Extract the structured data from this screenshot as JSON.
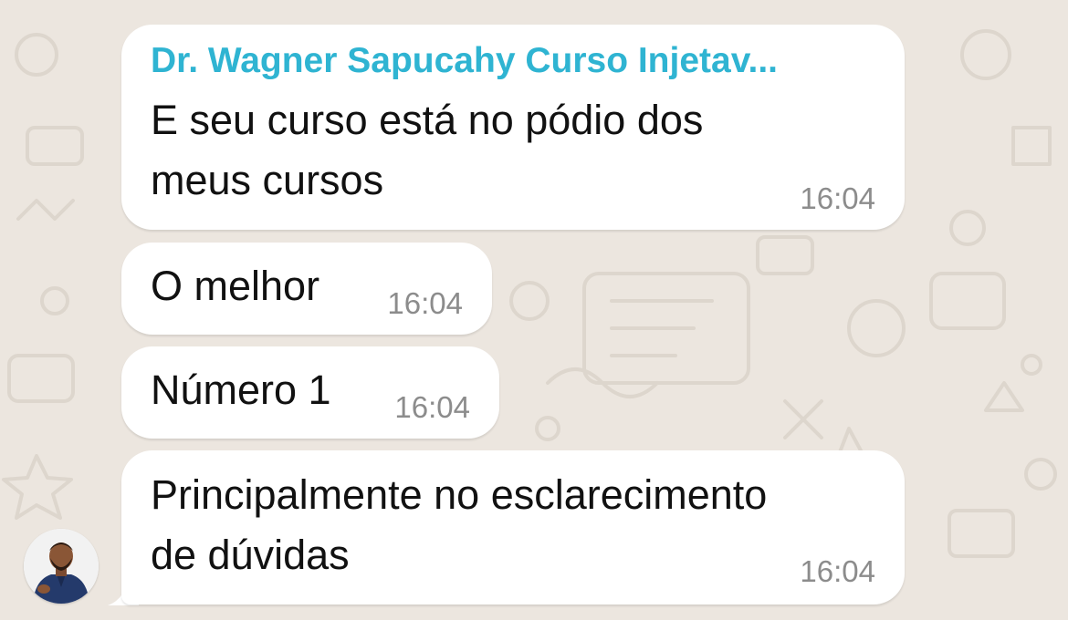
{
  "chat": {
    "sender_name": "Dr. Wagner Sapucahy Curso Injetav...",
    "messages": [
      {
        "lines": [
          "E seu curso está no pódio dos",
          "meus cursos"
        ],
        "time": "16:04"
      },
      {
        "lines": [
          "O melhor"
        ],
        "time": "16:04"
      },
      {
        "lines": [
          "Número 1"
        ],
        "time": "16:04"
      },
      {
        "lines": [
          "Principalmente no esclarecimento",
          "de dúvidas"
        ],
        "time": "16:04"
      }
    ]
  },
  "colors": {
    "background": "#ece6df",
    "bubble": "#ffffff",
    "sender_name": "#2fb4d2",
    "timestamp": "#8c8c8c",
    "message_text": "#111111"
  },
  "icons": {
    "avatar": "sender-avatar-photo"
  }
}
